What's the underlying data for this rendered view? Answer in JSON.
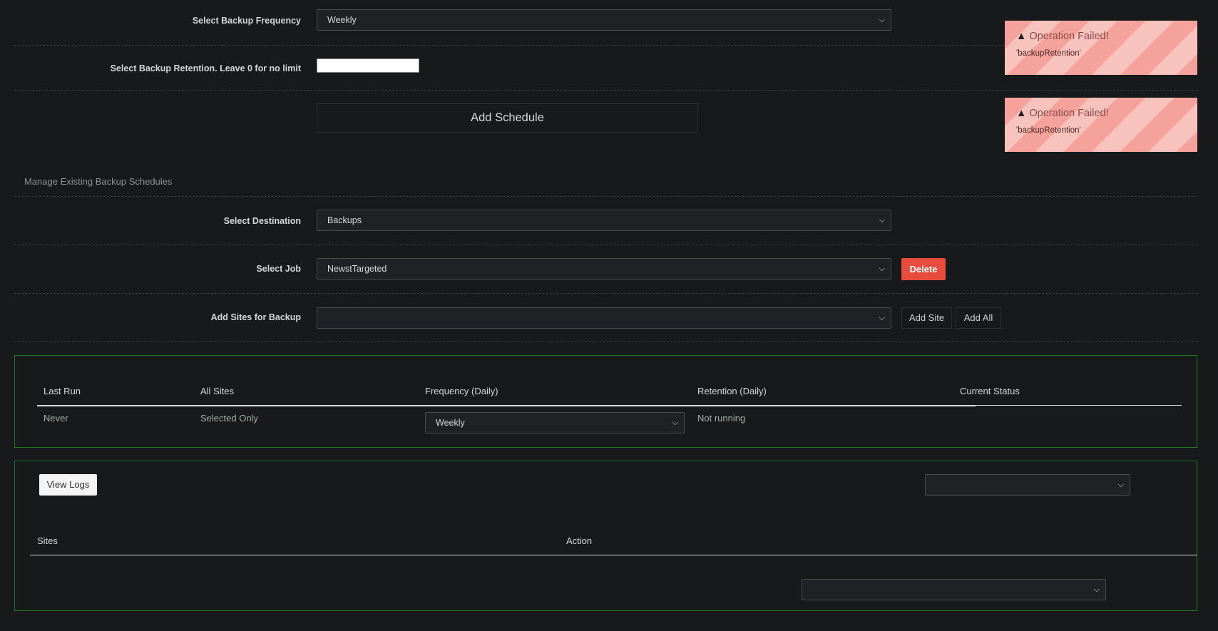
{
  "schedule_form": {
    "frequency_label": "Select Backup Frequency",
    "frequency_value": "Weekly",
    "retention_label": "Select Backup Retention. Leave 0 for no limit",
    "retention_value": "",
    "add_schedule_label": "Add Schedule"
  },
  "manage": {
    "section_title": "Manage Existing Backup Schedules",
    "destination_label": "Select Destination",
    "destination_value": "Backups",
    "job_label": "Select Job",
    "job_value": "NewstTargeted",
    "delete_label": "Delete",
    "add_sites_label": "Add Sites for Backup",
    "add_sites_value": "",
    "add_site_button": "Add Site",
    "add_all_button": "Add All"
  },
  "toasts": [
    {
      "title": "Operation Failed!",
      "message": "'backupRetention'"
    },
    {
      "title": "Operation Failed!",
      "message": "'backupRetention'"
    }
  ],
  "job_table": {
    "headers": [
      "Last Run",
      "All Sites",
      "Frequency (Daily)",
      "Retention (Daily)",
      "Current Status"
    ],
    "row": {
      "last_run": "Never",
      "all_sites": "Selected Only",
      "frequency": "Weekly",
      "retention": "Not running",
      "status": ""
    }
  },
  "logs_panel": {
    "view_logs_label": "View Logs",
    "top_select_value": "",
    "headers": [
      "Sites",
      "Action"
    ],
    "bottom_select_value": ""
  },
  "colors": {
    "background": "#18191b",
    "danger": "#e74c3c",
    "panel_border": "#1f7a22"
  }
}
